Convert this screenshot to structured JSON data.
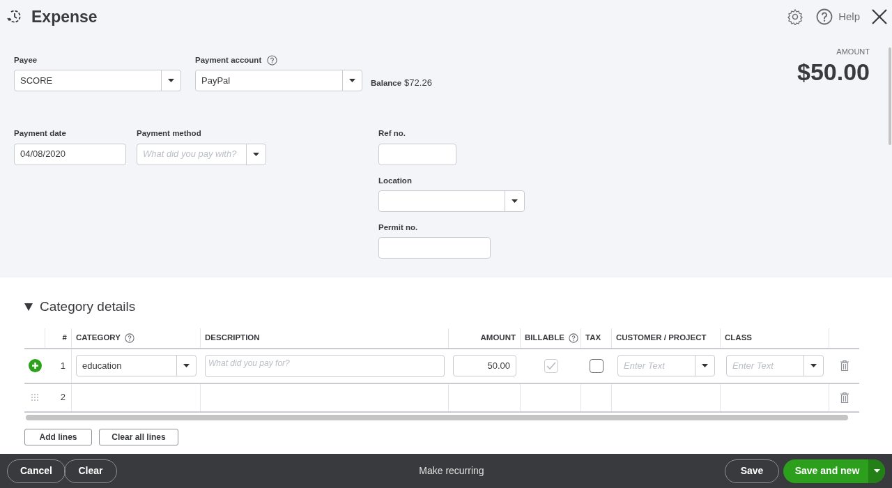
{
  "window": {
    "title": "Expense",
    "help": "Help"
  },
  "payee": {
    "label": "Payee",
    "value": "SCORE"
  },
  "payment_account": {
    "label": "Payment account",
    "value": "PayPal",
    "help": true
  },
  "balance": {
    "label": "Balance",
    "value": "$72.26"
  },
  "amount": {
    "label": "AMOUNT",
    "value": "$50.00"
  },
  "payment_date": {
    "label": "Payment date",
    "value": "04/08/2020"
  },
  "payment_method": {
    "label": "Payment method",
    "placeholder": "What did you pay with?"
  },
  "ref_no": {
    "label": "Ref no."
  },
  "location": {
    "label": "Location"
  },
  "permit_no": {
    "label": "Permit no."
  },
  "category_details": {
    "title": "Category details",
    "expanded": true,
    "columns": [
      {
        "label": "#",
        "help": false
      },
      {
        "label": "CATEGORY",
        "help": true
      },
      {
        "label": "DESCRIPTION",
        "help": false
      },
      {
        "label": "AMOUNT",
        "help": false
      },
      {
        "label": "BILLABLE",
        "help": true
      },
      {
        "label": "TAX",
        "help": false
      },
      {
        "label": "CUSTOMER / PROJECT",
        "help": false
      },
      {
        "label": "CLASS",
        "help": false
      }
    ],
    "rows": [
      {
        "number": "1",
        "editing": true,
        "category": "education",
        "description_placeholder": "What did you pay for?",
        "amount": "50.00",
        "billable": {
          "checked": true,
          "disabled": true
        },
        "tax": {
          "checked": false,
          "disabled": false
        },
        "customer_placeholder": "Enter Text",
        "class_placeholder": "Enter Text"
      },
      {
        "number": "2",
        "editing": false
      }
    ]
  },
  "line_buttons": [
    "Add lines",
    "Clear all lines"
  ],
  "footer": {
    "left": [
      "Cancel",
      "Clear"
    ],
    "center": "Make recurring",
    "save": "Save",
    "save_and_new": "Save and new"
  }
}
